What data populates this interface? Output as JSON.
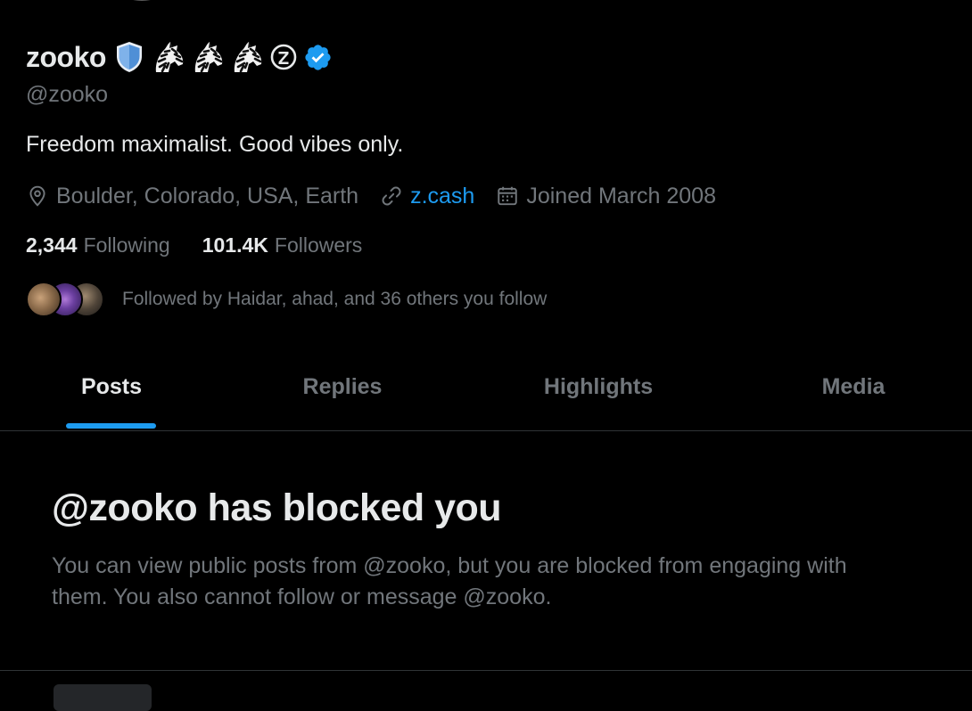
{
  "profile": {
    "display_name": "zooko",
    "handle": "@zooko",
    "bio": "Freedom maximalist. Good vibes only.",
    "location": "Boulder, Colorado, USA, Earth",
    "website": "z.cash",
    "joined": "Joined March 2008",
    "following_count": "2,344",
    "following_label": "Following",
    "followers_count": "101.4K",
    "followers_label": "Followers",
    "followed_by": "Followed by Haidar, ahad, and 36 others you follow",
    "name_emojis": [
      "shield-icon",
      "zebra-icon",
      "zebra-icon",
      "zebra-icon",
      "zcash-z-icon",
      "verified-badge-icon"
    ]
  },
  "tabs": [
    {
      "label": "Posts",
      "active": true
    },
    {
      "label": "Replies",
      "active": false
    },
    {
      "label": "Highlights",
      "active": false
    },
    {
      "label": "Media",
      "active": false
    }
  ],
  "blocked": {
    "title": "@zooko has blocked you",
    "description": "You can view public posts from @zooko, but you are blocked from engaging with them. You also cannot follow or message @zooko."
  },
  "colors": {
    "background": "#000000",
    "text_primary": "#e7e9ea",
    "text_secondary": "#71767b",
    "accent": "#1d9bf0",
    "divider": "#2f3336"
  }
}
